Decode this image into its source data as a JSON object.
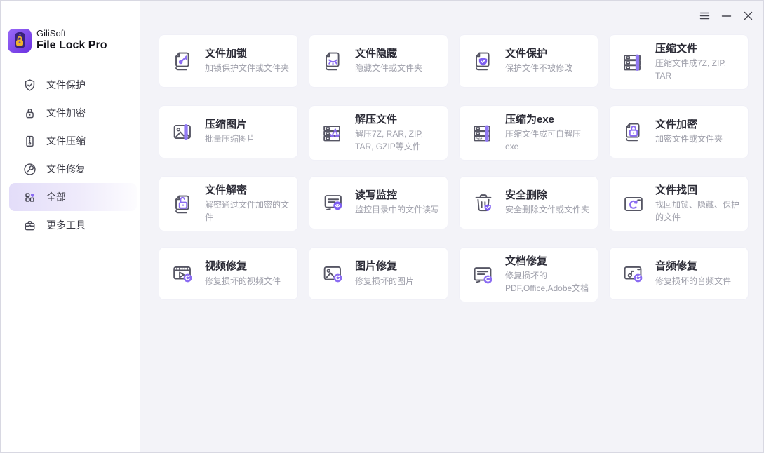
{
  "colors": {
    "accent": "#7d5ef0",
    "accent_light": "#8f76f3",
    "content_bg": "#f3f3f8",
    "sidebar_bg": "#ffffff",
    "card_bg": "#ffffff",
    "title_text": "#2c2c37",
    "desc_text": "#9fa0ab",
    "active_nav_bg": "#e3ddf9"
  },
  "brand": {
    "line1": "GiliSoft",
    "line2": "File Lock Pro",
    "logo_icon": "app-logo"
  },
  "window_controls": [
    {
      "name": "menu",
      "icon": "hamburger-icon"
    },
    {
      "name": "minimize",
      "icon": "minimize-icon"
    },
    {
      "name": "close",
      "icon": "close-icon"
    }
  ],
  "sidebar": {
    "items": [
      {
        "label": "文件保护",
        "icon": "shield-check-icon",
        "active": false
      },
      {
        "label": "文件加密",
        "icon": "lock-icon",
        "active": false
      },
      {
        "label": "文件压缩",
        "icon": "zip-file-icon",
        "active": false
      },
      {
        "label": "文件修复",
        "icon": "wrench-circle-icon",
        "active": false
      },
      {
        "label": "全部",
        "icon": "grid-heart-icon",
        "active": true
      },
      {
        "label": "更多工具",
        "icon": "toolbox-icon",
        "active": false
      }
    ]
  },
  "cards": [
    {
      "title": "文件加锁",
      "desc": "加锁保护文件或文件夹",
      "icon": "file-key-icon"
    },
    {
      "title": "文件隐藏",
      "desc": "隐藏文件或文件夹",
      "icon": "file-hide-icon"
    },
    {
      "title": "文件保护",
      "desc": "保护文件不被修改",
      "icon": "file-shield-icon"
    },
    {
      "title": "压缩文件",
      "desc": "压缩文件成7Z, ZIP, TAR",
      "icon": "archive-zip-icon"
    },
    {
      "title": "压缩图片",
      "desc": "批量压缩图片",
      "icon": "image-zip-icon"
    },
    {
      "title": "解压文件",
      "desc": "解压7Z, RAR, ZIP, TAR, GZIP等文件",
      "icon": "archive-extract-icon"
    },
    {
      "title": "压缩为exe",
      "desc": "压缩文件成可自解压exe",
      "icon": "archive-exe-icon"
    },
    {
      "title": "文件加密",
      "desc": "加密文件或文件夹",
      "icon": "file-lock-closed-icon"
    },
    {
      "title": "文件解密",
      "desc": "解密通过文件加密的文件",
      "icon": "file-lock-open-icon"
    },
    {
      "title": "读写监控",
      "desc": "监控目录中的文件读写",
      "icon": "monitor-eye-icon"
    },
    {
      "title": "安全删除",
      "desc": "安全删除文件或文件夹",
      "icon": "trash-shield-icon"
    },
    {
      "title": "文件找回",
      "desc": "找回加锁、隐藏、保护的文件",
      "icon": "window-restore-icon"
    },
    {
      "title": "视频修复",
      "desc": "修复损坏的视频文件",
      "icon": "video-repair-icon"
    },
    {
      "title": "图片修复",
      "desc": "修复损坏的图片",
      "icon": "image-repair-icon"
    },
    {
      "title": "文档修复",
      "desc": "修复损坏的PDF,Office,Adobe文档",
      "icon": "doc-repair-icon"
    },
    {
      "title": "音频修复",
      "desc": "修复损坏的音频文件",
      "icon": "audio-repair-icon"
    }
  ]
}
